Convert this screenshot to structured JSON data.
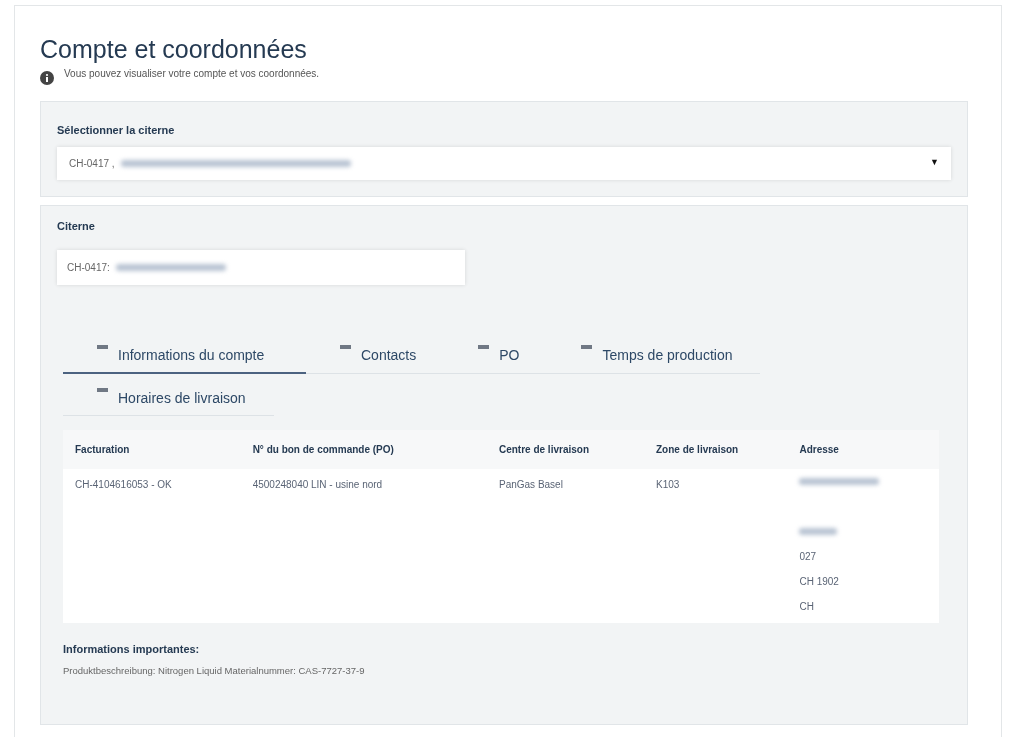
{
  "page": {
    "title": "Compte et coordonnées",
    "info": "Vous pouvez visualiser votre compte et vos coordonnées."
  },
  "tank_select": {
    "label": "Sélectionner la citerne",
    "value": "CH-0417 ,",
    "redacted": true,
    "caret": "▼"
  },
  "tank": {
    "label": "Citerne",
    "value": "CH-0417:",
    "redacted": true
  },
  "tabs": [
    {
      "label": "Informations du compte",
      "selected": true
    },
    {
      "label": "Contacts",
      "selected": false
    },
    {
      "label": "PO",
      "selected": false
    },
    {
      "label": "Temps de production",
      "selected": false
    },
    {
      "label": "Horaires de livraison",
      "selected": false
    }
  ],
  "table": {
    "columns": [
      "Facturation",
      "N° du bon de commande (PO)",
      "Centre de livraison",
      "Zone de livraison",
      "Adresse"
    ],
    "rows": [
      {
        "cells": [
          "CH-4104616053 - OK",
          "4500248040 LIN - usine nord",
          "PanGas Basel",
          "K103"
        ],
        "address": [
          {
            "kind": "redacted"
          },
          {
            "kind": "blank"
          },
          {
            "kind": "redacted"
          },
          {
            "kind": "text",
            "text": "027"
          },
          {
            "kind": "text",
            "text": "CH 1902"
          },
          {
            "kind": "text",
            "text": "CH"
          }
        ]
      }
    ]
  },
  "important": {
    "title": "Informations importantes:",
    "text": "Produktbeschreibung: Nitrogen Liquid Materialnummer: CAS-7727-37-9"
  }
}
